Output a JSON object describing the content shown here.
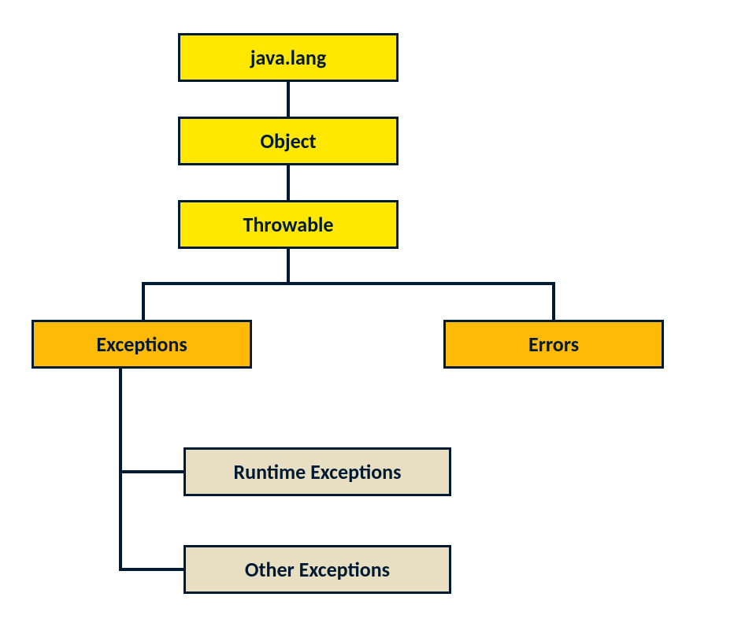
{
  "nodes": {
    "javaLang": "java.lang",
    "object": "Object",
    "throwable": "Throwable",
    "exceptions": "Exceptions",
    "errors": "Errors",
    "runtimeExceptions": "Runtime Exceptions",
    "otherExceptions": "Other Exceptions"
  }
}
